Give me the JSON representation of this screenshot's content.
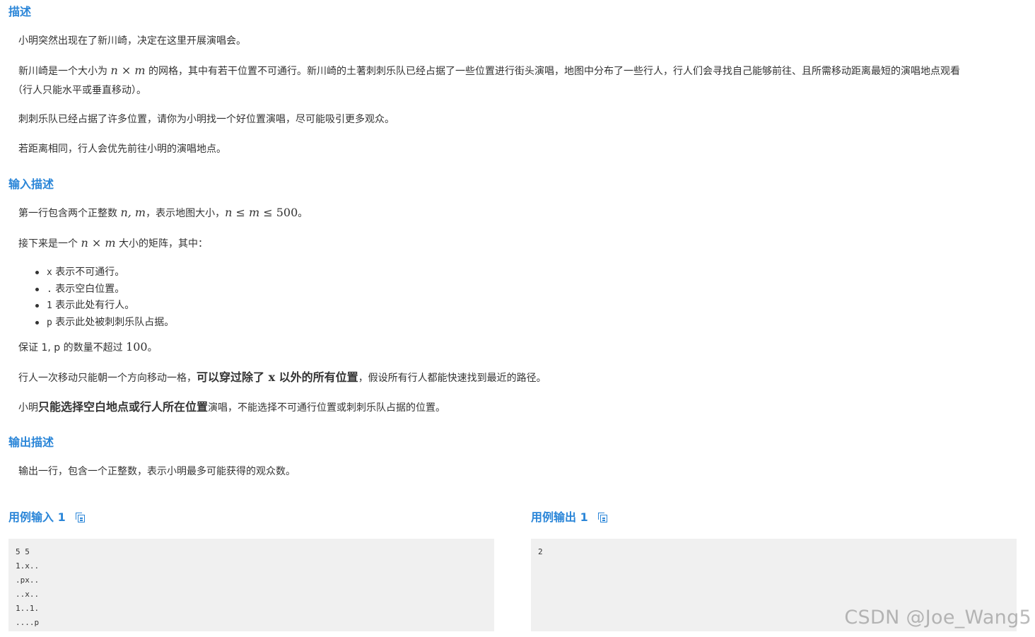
{
  "description": {
    "title": "描述",
    "p1": "小明突然出现在了新川崎，决定在这里开展演唱会。",
    "p2_a": "新川崎是一个大小为",
    "p2_n": "n",
    "p2_times": " × ",
    "p2_m": "m",
    "p2_b": "的网格，其中有若干位置不可通行。新川崎的土著刺刺乐队已经占据了一些位置进行街头演唱，地图中分布了一些行人，行人们会寻找自己能够前往、且所需移动距离最短的演唱地点观看",
    "p2_c": "（行人只能水平或垂直移动）。",
    "p3": "刺刺乐队已经占据了许多位置，请你为小明找一个好位置演唱，尽可能吸引更多观众。",
    "p4": "若距离相同，行人会优先前往小明的演唱地点。"
  },
  "input": {
    "title": "输入描述",
    "p1_a": "第一行包含两个正整数",
    "p1_vars": "n, m",
    "p1_b": "，表示地图大小，",
    "p1_n": "n",
    "p1_le1": " ≤ ",
    "p1_m": "m",
    "p1_le2": " ≤ ",
    "p1_max": "500",
    "p1_c": "。",
    "p2_a": "接下来是一个",
    "p2_n": "n",
    "p2_times": " × ",
    "p2_m": "m",
    "p2_b": "大小的矩阵，其中：",
    "bullets": [
      {
        "symbol": "x",
        "text": "表示不可通行。"
      },
      {
        "symbol": ".",
        "text": "表示空白位置。"
      },
      {
        "symbol": "1",
        "text": "表示此处有行人。"
      },
      {
        "symbol": "p",
        "text": "表示此处被刺刺乐队占据。"
      }
    ],
    "p3_a": "保证 1, p 的数量不超过",
    "p3_num": "100",
    "p3_b": "。",
    "p4_a": "行人一次移动只能朝一个方向移动一格，",
    "p4_bold": "可以穿过除了 x 以外的所有位置",
    "p4_b": "，假设所有行人都能快速找到最近的路径。",
    "p5_a": "小明",
    "p5_bold": "只能选择空白地点或行人所在位置",
    "p5_b": "演唱，不能选择不可通行位置或刺刺乐队占据的位置。"
  },
  "output": {
    "title": "输出描述",
    "p1": "输出一行，包含一个正整数，表示小明最多可能获得的观众数。"
  },
  "sample_input": {
    "title": "用例输入 1",
    "code": "5 5\n1.x..\n.px..\n..x..\n1..1.\n....p"
  },
  "sample_output": {
    "title": "用例输出 1",
    "code": "2"
  },
  "watermark": "CSDN @Joe_Wang5",
  "colors": {
    "heading": "#2b86d8",
    "text": "#333333",
    "code_bg": "#f0f0f0"
  }
}
